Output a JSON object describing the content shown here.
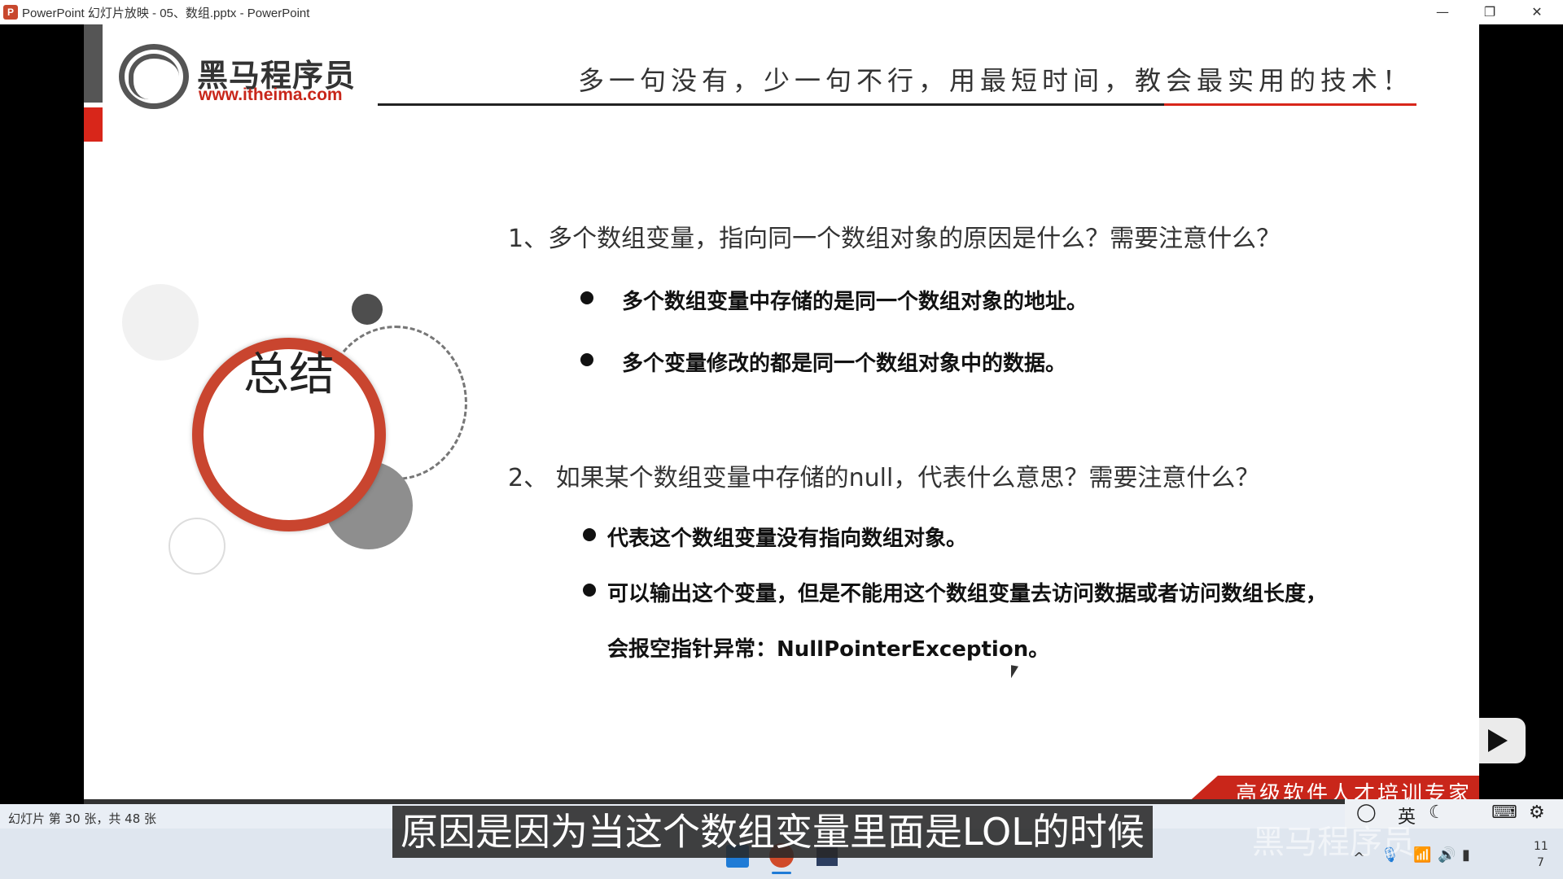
{
  "window": {
    "title": "PowerPoint 幻灯片放映 - 05、数组.pptx - PowerPoint",
    "app_icon": "P",
    "minimize": "—",
    "restore": "❐",
    "close": "✕"
  },
  "slide": {
    "logo": {
      "name": "黑马程序员",
      "url": "www.itheima.com"
    },
    "slogan": "多一句没有，少一句不行，用最短时间，教会最实用的技术！",
    "summary_label": "总结",
    "q1": "1、多个数组变量，指向同一个数组对象的原因是什么？需要注意什么？",
    "q1_bullets": [
      "多个数组变量中存储的是同一个数组对象的地址。",
      "多个变量修改的都是同一个数组对象中的数据。"
    ],
    "q2": "2、 如果某个数组变量中存储的null，代表什么意思？需要注意什么？",
    "q2_bullets": [
      "代表这个数组变量没有指向数组对象。",
      "可以输出这个变量，但是不能用这个数组变量去访问数据或者访问数组长度，",
      "会报空指针异常：NullPointerException。"
    ],
    "banner": "高级软件人才培训专家"
  },
  "status": {
    "slide_count": "幻灯片 第 30 张，共 48 张"
  },
  "tray": {
    "ime": "英",
    "clock_a": "11",
    "clock_b": "7",
    "chevron": "^"
  },
  "subtitle": "原因是因为当这个数组变量里面是LOL的时候",
  "watermark": "黑马程序员",
  "colors": {
    "accent_red": "#c9261a",
    "ring_red": "#c9452f"
  }
}
